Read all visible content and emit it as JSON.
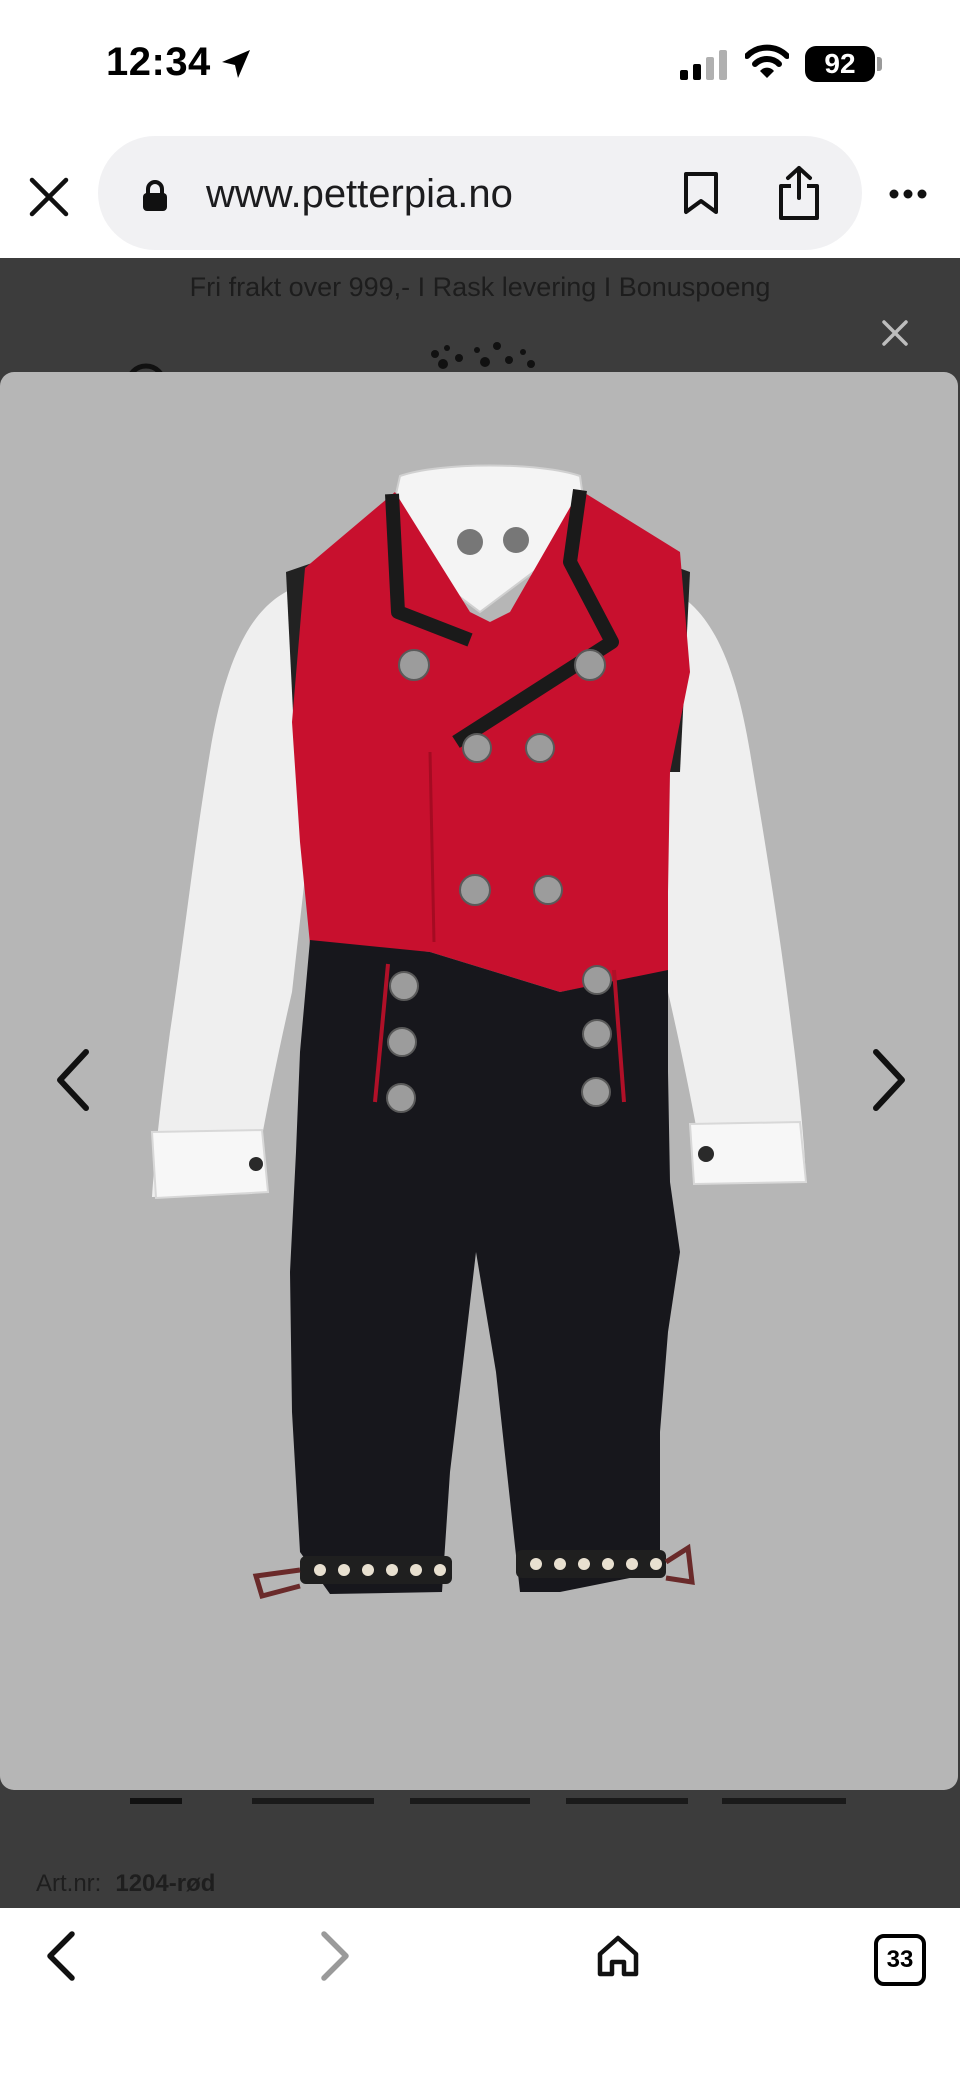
{
  "status_bar": {
    "time": "12:34",
    "battery": "92",
    "icons": [
      "location-arrow-icon",
      "cellular-signal-icon",
      "wifi-icon",
      "battery-icon"
    ]
  },
  "browser": {
    "url": "www.petterpia.no",
    "icons": [
      "close-icon",
      "lock-icon",
      "bookmark-icon",
      "share-icon",
      "more-icon"
    ]
  },
  "page": {
    "promo": "Fri frakt over 999,- I Rask levering I Bonuspoeng",
    "art_nr_label": "Art.nr:",
    "art_nr_value": "1204-rød"
  },
  "viewer": {
    "image": "boys-bunad-red-vest-black-knickers",
    "prev_icon": "chevron-left-icon",
    "next_icon": "chevron-right-icon"
  },
  "toolbar": {
    "tab_count": "33",
    "icons": [
      "back-icon",
      "forward-icon",
      "home-icon",
      "tabs-icon"
    ]
  },
  "colors": {
    "vest_red": "#c8102e",
    "backdrop": "#b6b6b6",
    "dim_page": "#3c3c3c",
    "pill": "#f1f1f3"
  }
}
